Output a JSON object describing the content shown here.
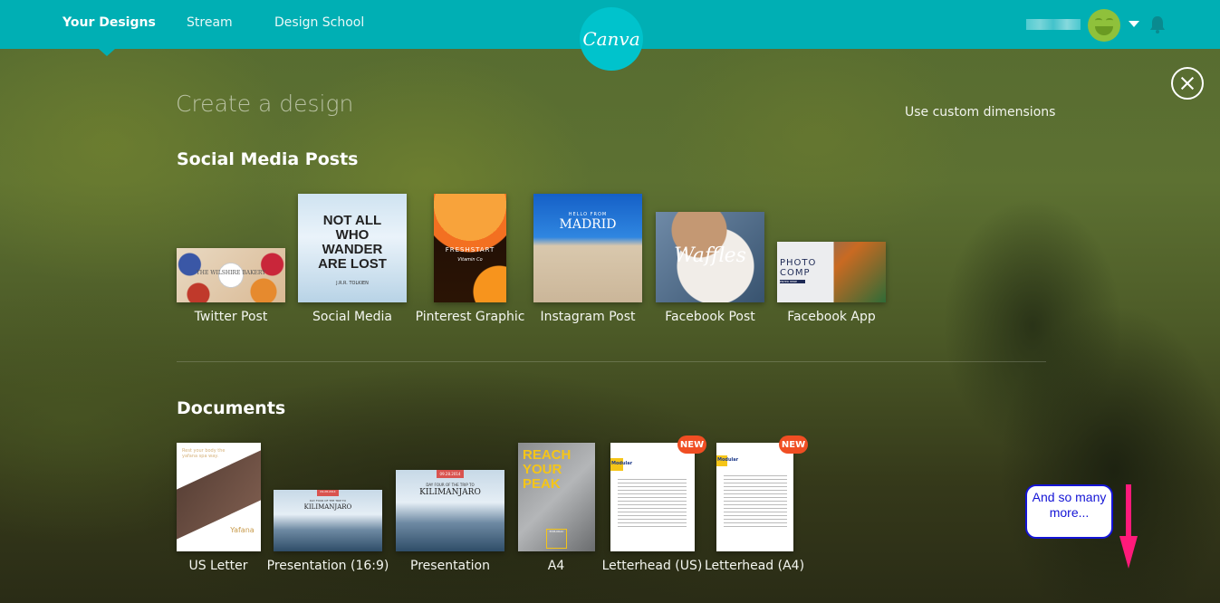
{
  "app": {
    "logo_text": "Canva"
  },
  "nav": {
    "items": [
      {
        "label": "Your Designs",
        "active": true
      },
      {
        "label": "Stream",
        "active": false
      },
      {
        "label": "Design School",
        "active": false
      }
    ]
  },
  "user": {
    "avatar_icon": "smiley-avatar",
    "notifications_icon": "bell-icon"
  },
  "page": {
    "title": "Create a design",
    "custom_dimensions_link": "Use custom dimensions",
    "close_icon": "close-circle-icon"
  },
  "sections": [
    {
      "title": "Social Media Posts",
      "items": [
        {
          "label": "Twitter Post",
          "thumb_text": "THE WILSHIRE BAKERY"
        },
        {
          "label": "Social Media",
          "thumb_text": "NOT ALL WHO WANDER ARE LOST",
          "thumb_subtext": "J.R.R. TOLKIEN"
        },
        {
          "label": "Pinterest Graphic",
          "thumb_text": "FRESHSTART",
          "thumb_subtext": "Vitamin Co"
        },
        {
          "label": "Instagram Post",
          "thumb_text": "MADRID",
          "thumb_subtext": "HELLO FROM"
        },
        {
          "label": "Facebook Post",
          "thumb_text": "Waffles"
        },
        {
          "label": "Facebook App",
          "thumb_text": "PHOTO COMP",
          "thumb_subtext": "ENTER HERE"
        }
      ]
    },
    {
      "title": "Documents",
      "items": [
        {
          "label": "US Letter",
          "thumb_text": "Yafana",
          "thumb_subtext": "Rest your body the yafana spa way."
        },
        {
          "label": "Presentation (16:9)",
          "thumb_text": "KILIMANJARO",
          "thumb_subtext": "DAY FOUR OF THE TRIP TO",
          "thumb_date": "09.28.2014"
        },
        {
          "label": "Presentation",
          "thumb_text": "KILIMANJARO",
          "thumb_subtext": "DAY FOUR OF THE TRIP TO",
          "thumb_date": "09.28.2014"
        },
        {
          "label": "A4",
          "thumb_text": "REACH YOUR PEAK",
          "thumb_subtext": "EXPLORAC"
        },
        {
          "label": "Letterhead (US)",
          "thumb_text": "Modular",
          "badge": "NEW"
        },
        {
          "label": "Letterhead (A4)",
          "thumb_text": "Modular",
          "badge": "NEW"
        }
      ]
    }
  ],
  "annotation": {
    "callout_text": "And so many more...",
    "arrow_color": "#ff1a7a",
    "callout_color": "#1414d6"
  },
  "colors": {
    "brand": "#00afb4",
    "logo_circle": "#00c3cc",
    "badge_new": "#f04e23",
    "avatar": "#8fc13b"
  }
}
